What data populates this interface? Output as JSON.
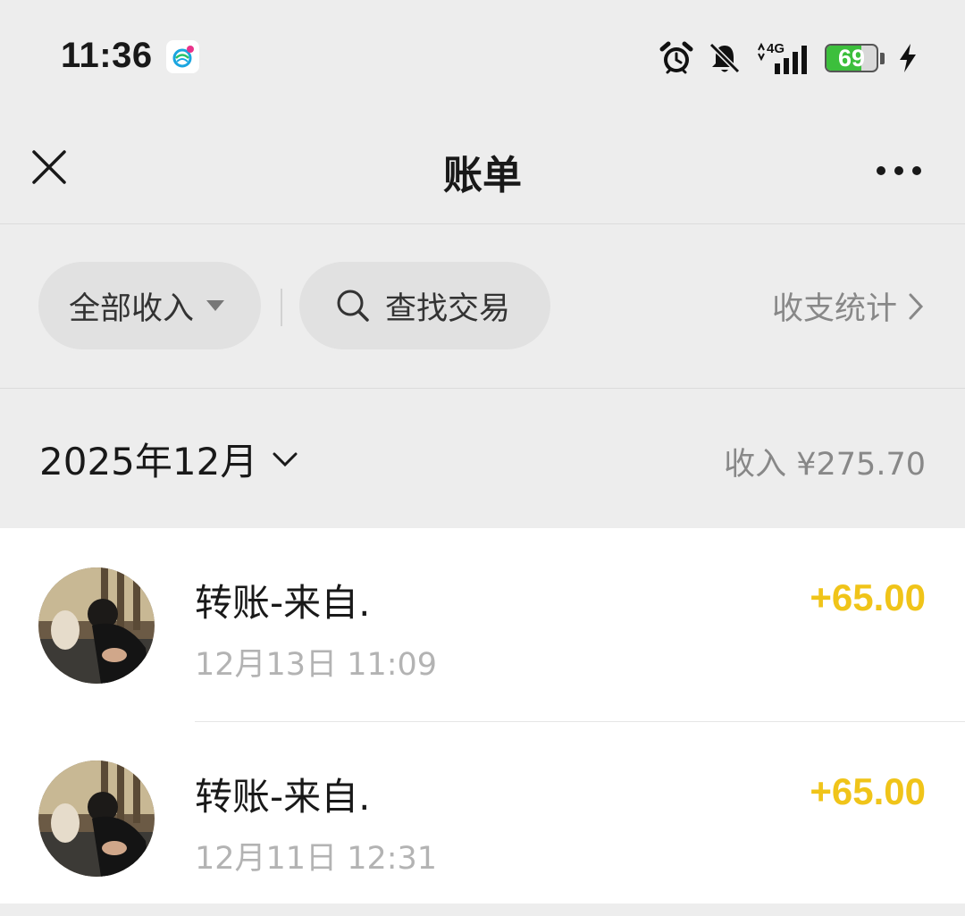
{
  "status_bar": {
    "time": "11:36",
    "network": "4G",
    "battery_level": "69",
    "icons": [
      "china-mobile-icon",
      "alarm-icon",
      "bell-muted-icon",
      "signal-4g-icon",
      "battery-icon",
      "charging-icon"
    ]
  },
  "nav": {
    "title": "账单",
    "close_icon": "close-icon",
    "more_icon": "more-icon"
  },
  "filters": {
    "type_filter": "全部收入",
    "search": "查找交易",
    "stats": "收支统计"
  },
  "month": {
    "label": "2025年12月",
    "income": "收入 ¥275.70"
  },
  "transactions": [
    {
      "title": "转账-来自.",
      "time": "12月13日 11:09",
      "amount": "+65.00"
    },
    {
      "title": "转账-来自.",
      "time": "12月11日 12:31",
      "amount": "+65.00"
    }
  ],
  "colors": {
    "background": "#ededed",
    "amount_positive": "#f0c419",
    "battery_green": "#3cbf3c"
  }
}
